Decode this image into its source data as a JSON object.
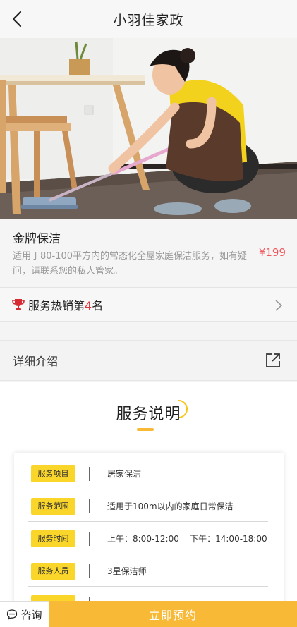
{
  "header": {
    "title": "小羽佳家政",
    "back_icon": "chevron-left-icon"
  },
  "product": {
    "name": "金牌保洁",
    "description": "适用于80-100平方内的常态化全屋家庭保洁服务，如有疑问，请联系您的私人管家。",
    "price": "¥199"
  },
  "ranking": {
    "prefix": "服务热销第",
    "number": "4",
    "suffix": "名",
    "icon": "trophy-icon"
  },
  "detail": {
    "label": "详细介绍",
    "share_icon": "share-icon"
  },
  "service": {
    "title": "服务说明",
    "rows": [
      {
        "tag": "服务项目",
        "value": "居家保洁"
      },
      {
        "tag": "服务范围",
        "value": "适用于100m以内的家庭日常保洁"
      },
      {
        "tag": "服务时间",
        "value": "上午：8:00-12:00    下午：14:00-18:00"
      },
      {
        "tag": "服务人员",
        "value": "3星保洁师"
      }
    ]
  },
  "bottom": {
    "consult_label": "咨询",
    "book_label": "立即预约"
  },
  "colors": {
    "accent": "#f8b936",
    "price": "#f2575e",
    "rank_number": "#e5333b",
    "tag": "#fbd62a"
  }
}
